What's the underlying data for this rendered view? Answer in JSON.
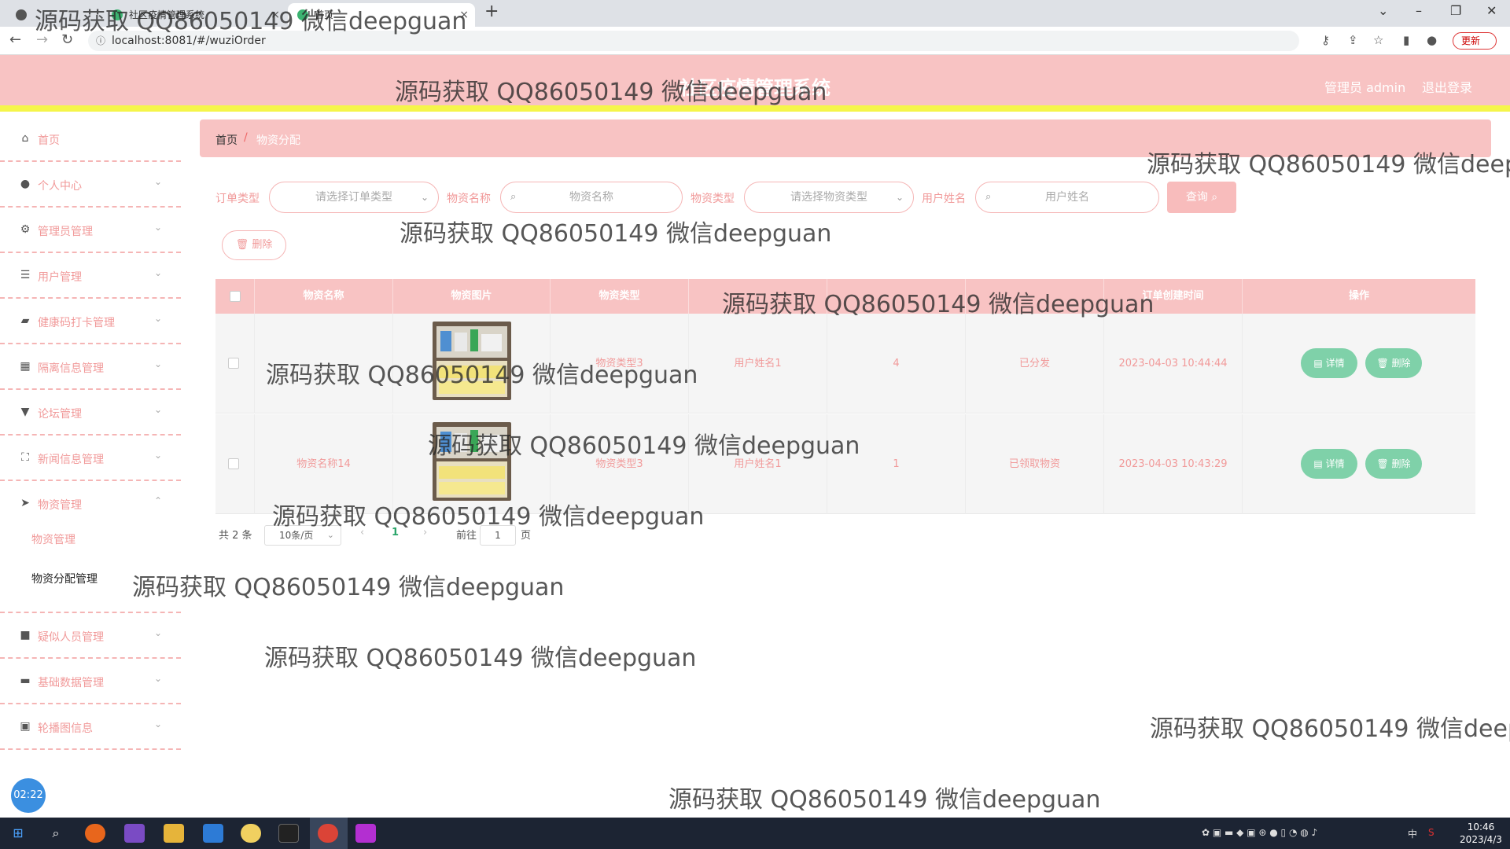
{
  "browser": {
    "tabs": [
      {
        "title": "社区疫情管理系统"
      },
      {
        "title": "首页"
      }
    ],
    "url": "localhost:8081/#/wuziOrder",
    "update_label": "更新"
  },
  "header": {
    "title": "社区疫情管理系统",
    "user_label": "管理员 admin",
    "logout_label": "退出登录"
  },
  "sidebar": {
    "items": [
      {
        "label": "首页",
        "icon": "home-icon"
      },
      {
        "label": "个人中心",
        "icon": "user-icon"
      },
      {
        "label": "管理员管理",
        "icon": "settings-icon"
      },
      {
        "label": "用户管理",
        "icon": "sliders-icon"
      },
      {
        "label": "健康码打卡管理",
        "icon": "briefcase-icon"
      },
      {
        "label": "隔离信息管理",
        "icon": "grid-icon"
      },
      {
        "label": "论坛管理",
        "icon": "forum-icon"
      },
      {
        "label": "新闻信息管理",
        "icon": "expand-icon"
      },
      {
        "label": "物资管理",
        "icon": "send-icon"
      },
      {
        "label": "疑似人员管理",
        "icon": "camera-icon"
      },
      {
        "label": "基础数据管理",
        "icon": "monitor-icon"
      },
      {
        "label": "轮播图信息",
        "icon": "delete-icon"
      }
    ],
    "sub_items": [
      {
        "label": "物资管理"
      },
      {
        "label": "物资分配管理"
      }
    ]
  },
  "breadcrumb": {
    "home": "首页",
    "separator": "/",
    "current": "物资分配"
  },
  "filters": {
    "order_type_label": "订单类型",
    "order_type_placeholder": "请选择订单类型",
    "wuzi_name_label": "物资名称",
    "wuzi_name_placeholder": "物资名称",
    "wuzi_type_label": "物资类型",
    "wuzi_type_placeholder": "请选择物资类型",
    "user_name_label": "用户姓名",
    "user_name_placeholder": "用户姓名",
    "query_label": "查询",
    "delete_label": "删除"
  },
  "table": {
    "columns": [
      "物资名称",
      "物资图片",
      "物资类型",
      "",
      "",
      "",
      "订单创建时间",
      "操作"
    ],
    "rows": [
      {
        "name": "",
        "type": "物资类型3",
        "user": "用户姓名1",
        "qty": "4",
        "status": "已分发",
        "time": "2023-04-03 10:44:44"
      },
      {
        "name": "物资名称14",
        "type": "物资类型3",
        "user": "用户姓名1",
        "qty": "1",
        "status": "已领取物资",
        "time": "2023-04-03 10:43:29"
      }
    ],
    "detail_label": "详情",
    "delete_label": "删除"
  },
  "pagination": {
    "total": "共 2 条",
    "page_size": "10条/页",
    "current": "1",
    "goto_label": "前往",
    "goto_value": "1",
    "page_suffix": "页"
  },
  "timer": "02:22",
  "taskbar": {
    "time": "10:46",
    "date": "2023/4/3",
    "ime": "中"
  },
  "watermarks": [
    "源码获取 QQ86050149 微信deepguan",
    "源码获取 QQ86050149 微信deepguan",
    "源码获取 QQ86050149 微信deep",
    "源码获取 QQ86050149 微信deepguan",
    "源码获取 QQ86050149 微信deepguan",
    "源码获取 QQ86050149 微信deepguan",
    "源码获取 QQ86050149 微信deepguan",
    "源码获取 QQ86050149 微信deepguan",
    "源码获取 QQ86050149 微信deepguan",
    "源码获取 QQ86050149 微信deepguan",
    "源码获取 QQ86050149 微信deep",
    "源码获取 QQ86050149 微信deepguan"
  ]
}
